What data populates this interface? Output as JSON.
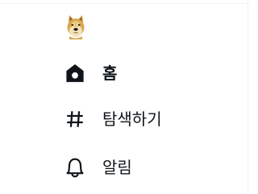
{
  "sidebar": {
    "logo": {
      "icon": "doge-dog-icon"
    },
    "items": [
      {
        "icon": "home-icon",
        "label": "홈",
        "active": true
      },
      {
        "icon": "hashtag-icon",
        "label": "탐색하기",
        "active": false
      },
      {
        "icon": "bell-icon",
        "label": "알림",
        "active": false
      }
    ]
  },
  "colors": {
    "text": "#0f1419",
    "border": "#eff3f4",
    "background": "#ffffff"
  }
}
